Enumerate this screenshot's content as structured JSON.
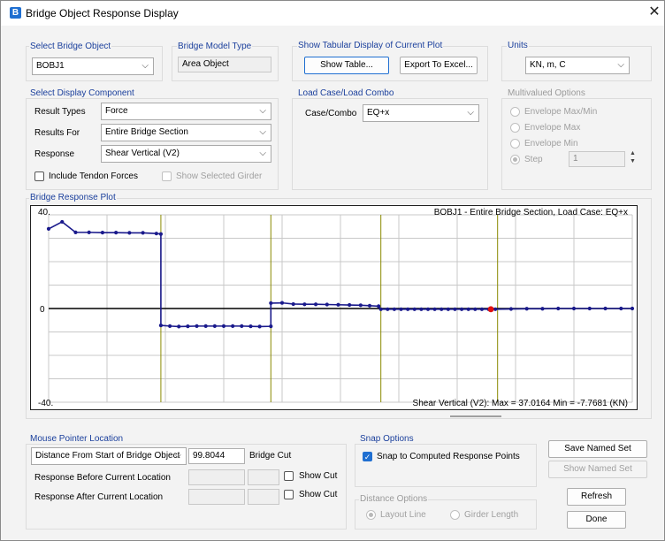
{
  "window": {
    "title": "Bridge Object Response Display",
    "app_icon_letter": "B"
  },
  "select_bridge_object": {
    "label": "Select Bridge Object",
    "value": "BOBJ1"
  },
  "bridge_model_type": {
    "label": "Bridge Model Type",
    "value": "Area Object"
  },
  "tabular": {
    "label": "Show Tabular Display of Current Plot",
    "show_table": "Show Table...",
    "export_excel": "Export To Excel..."
  },
  "units": {
    "label": "Units",
    "value": "KN, m, C"
  },
  "display_component": {
    "label": "Select Display Component",
    "result_types_label": "Result Types",
    "result_types_value": "Force",
    "results_for_label": "Results For",
    "results_for_value": "Entire Bridge Section",
    "response_label": "Response",
    "response_value": "Shear Vertical  (V2)",
    "include_tendon": "Include Tendon Forces",
    "show_selected_girder": "Show Selected Girder"
  },
  "load_case": {
    "label": "Load Case/Load Combo",
    "case_label": "Case/Combo",
    "case_value": "EQ+x"
  },
  "multivalued": {
    "label": "Multivalued Options",
    "opt_max_min": "Envelope Max/Min",
    "opt_max": "Envelope Max",
    "opt_min": "Envelope Min",
    "opt_step": "Step",
    "step_value": "1"
  },
  "plot": {
    "label": "Bridge Response Plot",
    "header": "BOBJ1 - Entire Bridge Section,  Load Case: EQ+x",
    "footer": "Shear Vertical  (V2):  Max = 37.0164    Min = -7.7681  (KN)",
    "ymax_label": "40.",
    "ymin_label": "-40.",
    "zero_label": "0"
  },
  "chart_data": {
    "type": "line",
    "x_scale": "distance along bridge (unlabeled)",
    "ylim": [
      -40,
      40
    ],
    "grid": true,
    "series": [
      {
        "values": [
          [
            0.0,
            34.0
          ],
          [
            0.03,
            37.0
          ],
          [
            0.06,
            32.5
          ],
          [
            0.09,
            32.5
          ],
          [
            0.12,
            32.4
          ],
          [
            0.15,
            32.4
          ],
          [
            0.18,
            32.3
          ],
          [
            0.21,
            32.3
          ],
          [
            0.24,
            32.0
          ],
          [
            0.25,
            31.8
          ],
          [
            0.25,
            -7.2
          ],
          [
            0.27,
            -7.5
          ],
          [
            0.29,
            -7.7
          ],
          [
            0.31,
            -7.6
          ],
          [
            0.33,
            -7.5
          ],
          [
            0.35,
            -7.5
          ],
          [
            0.37,
            -7.5
          ],
          [
            0.39,
            -7.5
          ],
          [
            0.41,
            -7.5
          ],
          [
            0.43,
            -7.5
          ],
          [
            0.45,
            -7.6
          ],
          [
            0.47,
            -7.7
          ],
          [
            0.495,
            -7.6
          ],
          [
            0.495,
            2.3
          ],
          [
            0.52,
            2.4
          ],
          [
            0.545,
            1.9
          ],
          [
            0.57,
            1.8
          ],
          [
            0.595,
            1.8
          ],
          [
            0.62,
            1.7
          ],
          [
            0.645,
            1.6
          ],
          [
            0.67,
            1.5
          ],
          [
            0.695,
            1.4
          ],
          [
            0.715,
            1.2
          ],
          [
            0.735,
            1.0
          ],
          [
            0.74,
            -0.3
          ],
          [
            0.755,
            -0.3
          ],
          [
            0.77,
            -0.3
          ],
          [
            0.785,
            -0.3
          ],
          [
            0.8,
            -0.3
          ],
          [
            0.815,
            -0.3
          ],
          [
            0.83,
            -0.3
          ],
          [
            0.845,
            -0.3
          ],
          [
            0.86,
            -0.3
          ],
          [
            0.875,
            -0.3
          ],
          [
            0.89,
            -0.3
          ],
          [
            0.905,
            -0.3
          ],
          [
            0.92,
            -0.3
          ],
          [
            0.935,
            -0.3
          ],
          [
            0.95,
            -0.3
          ],
          [
            0.965,
            -0.3
          ],
          [
            0.98,
            -0.3
          ],
          [
            0.995,
            -0.3
          ],
          [
            1.03,
            -0.2
          ],
          [
            1.065,
            -0.1
          ],
          [
            1.1,
            -0.1
          ],
          [
            1.135,
            0.0
          ],
          [
            1.17,
            0.0
          ],
          [
            1.205,
            0.0
          ],
          [
            1.24,
            0.0
          ],
          [
            1.275,
            0.0
          ],
          [
            1.3,
            0.0
          ]
        ]
      }
    ],
    "span_dividers": [
      0.25,
      0.495,
      0.74,
      1.0
    ],
    "cursor_point": [
      0.985,
      -0.3
    ]
  },
  "mouse_pointer": {
    "label": "Mouse Pointer Location",
    "mode_value": "Distance From Start of Bridge Object",
    "distance_value": "99.8044",
    "bridge_cut": "Bridge Cut",
    "before_label": "Response Before Current Location",
    "after_label": "Response After Current Location",
    "show_cut_1": "Show Cut",
    "show_cut_2": "Show Cut"
  },
  "snap": {
    "label": "Snap Options",
    "snap_label": "Snap to Computed Response Points"
  },
  "distance_options": {
    "label": "Distance Options",
    "layout_line": "Layout Line",
    "girder_length": "Girder Length"
  },
  "buttons": {
    "save_named_set": "Save Named Set",
    "show_named_set": "Show Named Set",
    "refresh": "Refresh",
    "done": "Done"
  }
}
